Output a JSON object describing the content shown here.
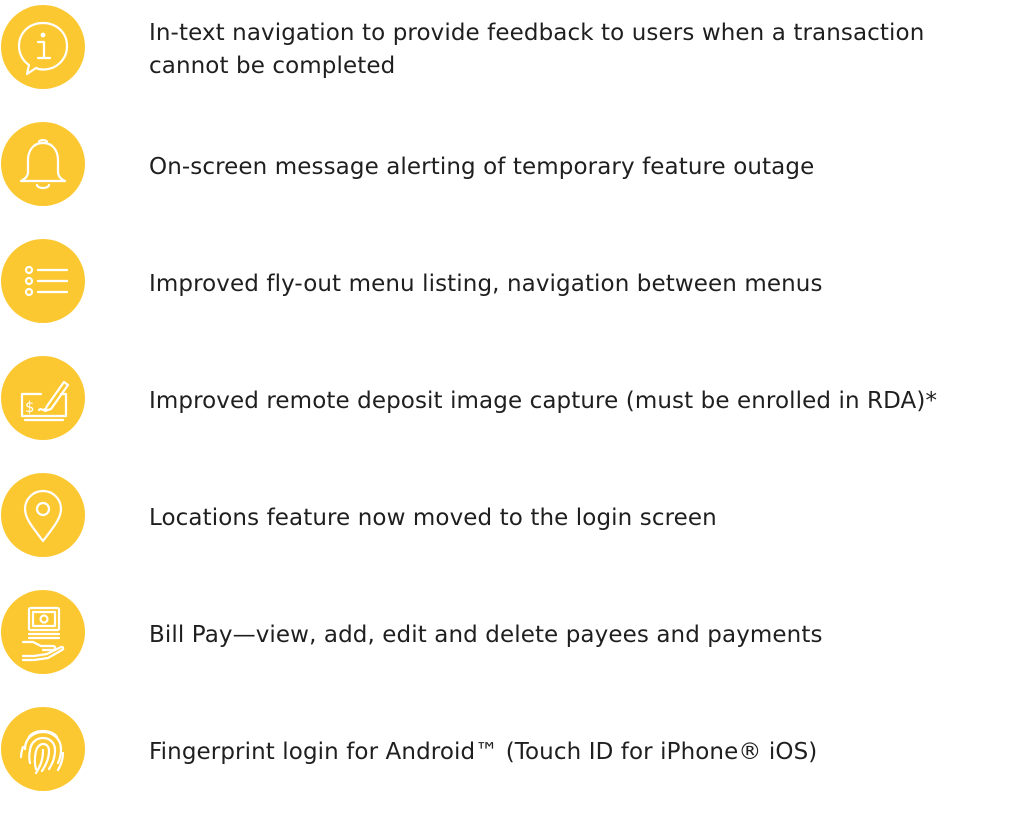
{
  "accent_color": "#fcc832",
  "text_color": "#1f1f1f",
  "features": [
    {
      "icon": "info-bubble-icon",
      "text": "In-text navigation to provide feedback to users when a transaction cannot be completed"
    },
    {
      "icon": "bell-icon",
      "text": "On-screen message alerting of temporary feature outage"
    },
    {
      "icon": "menu-list-icon",
      "text": "Improved fly-out menu listing, navigation between menus"
    },
    {
      "icon": "check-deposit-icon",
      "text": "Improved remote deposit image capture (must be enrolled in RDA)*"
    },
    {
      "icon": "location-pin-icon",
      "text": "Locations feature now moved to the login screen"
    },
    {
      "icon": "bill-pay-icon",
      "text": "Bill Pay—view, add, edit and delete payees and payments"
    },
    {
      "icon": "fingerprint-icon",
      "text": "Fingerprint login for Android™ (Touch ID for iPhone® iOS)"
    }
  ]
}
